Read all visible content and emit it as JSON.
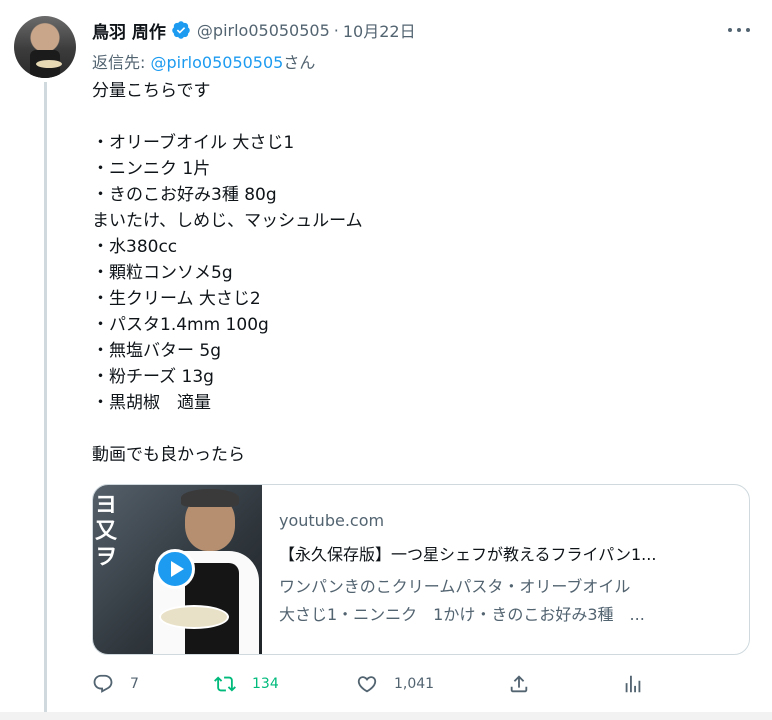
{
  "tweet": {
    "display_name": "鳥羽 周作",
    "handle": "@pirlo05050505",
    "separator": "·",
    "date": "10月22日",
    "reply_prefix": "返信先: ",
    "reply_mention": "@pirlo05050505",
    "reply_suffix": "さん",
    "body_lines": [
      "分量こちらです",
      "",
      "・オリーブオイル 大さじ1",
      "・ニンニク 1片",
      "・きのこお好み3種 80g",
      "まいたけ、しめじ、マッシュルーム",
      "・水380cc",
      "・顆粒コンソメ5g",
      "・生クリーム 大さじ2",
      "・パスタ1.4mm 100g",
      "・無塩バター 5g",
      "・粉チーズ 13g",
      "・黒胡椒　適量",
      "",
      "動画でも良かったら"
    ],
    "card": {
      "domain": "youtube.com",
      "title": "【永久保存版】一つ星シェフが教えるフライパン1...",
      "description_lines": [
        "ワンパンきのこクリームパスタ・オリーブオイル",
        "大さじ1・ニンニク　1かけ・きのこお好み3種　..."
      ],
      "thumbnail_text": "ヨ又ヲ"
    },
    "actions": {
      "reply_count": "7",
      "retweet_count": "134",
      "like_count": "1,041"
    }
  },
  "colors": {
    "accent": "#1d9bf0",
    "secondary_text": "#536471",
    "retweet_active": "#00ba7c",
    "border": "#cfd9de"
  },
  "icons": [
    "verified-badge-icon",
    "more-icon",
    "play-icon",
    "reply-icon",
    "retweet-icon",
    "like-icon",
    "share-icon",
    "analytics-icon"
  ]
}
